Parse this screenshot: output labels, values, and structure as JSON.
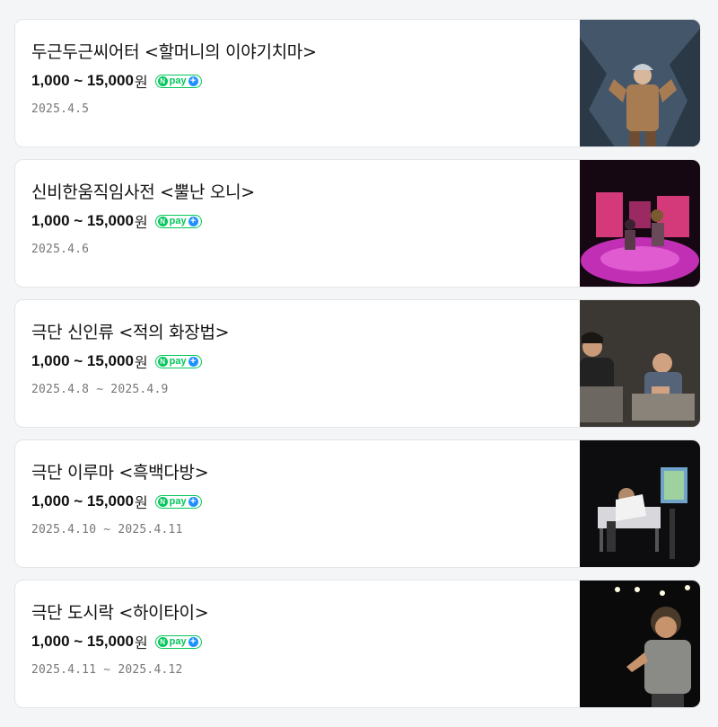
{
  "events": [
    {
      "title": "두근두근씨어터 <할머니의 이야기치마>",
      "price": "1,000 ~ 15,000",
      "price_unit": "원",
      "pay_label": "pay",
      "date": "2025.4.5",
      "thumbnail_icon": "performance-photo"
    },
    {
      "title": "신비한움직임사전 <뿔난 오니>",
      "price": "1,000 ~ 15,000",
      "price_unit": "원",
      "pay_label": "pay",
      "date": "2025.4.6",
      "thumbnail_icon": "performance-photo"
    },
    {
      "title": "극단 신인류 <적의 화장법>",
      "price": "1,000 ~ 15,000",
      "price_unit": "원",
      "pay_label": "pay",
      "date": "2025.4.8 ~ 2025.4.9",
      "thumbnail_icon": "performance-photo"
    },
    {
      "title": "극단 이루마 <흑백다방>",
      "price": "1,000 ~ 15,000",
      "price_unit": "원",
      "pay_label": "pay",
      "date": "2025.4.10 ~ 2025.4.11",
      "thumbnail_icon": "performance-photo"
    },
    {
      "title": "극단 도시락 <하이타이>",
      "price": "1,000 ~ 15,000",
      "price_unit": "원",
      "pay_label": "pay",
      "date": "2025.4.11 ~ 2025.4.12",
      "thumbnail_icon": "performance-photo"
    }
  ],
  "colors": {
    "npay_green": "#03c75a",
    "npay_plus_blue": "#1e90ff",
    "date_gray": "#777777"
  }
}
